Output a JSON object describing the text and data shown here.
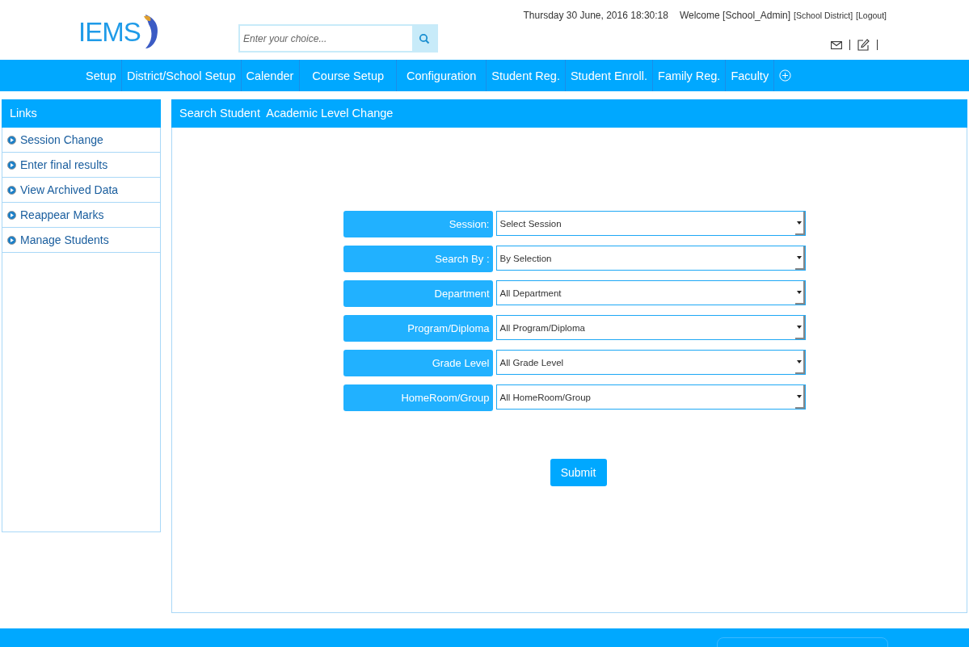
{
  "header": {
    "logo_text": "IEMS",
    "search": {
      "placeholder": "Enter your choice..."
    },
    "datetime": "Thursday 30 June, 2016 18:30:18",
    "welcome": "Welcome [School_Admin]",
    "district_link": "[School District]",
    "logout_link": "[Logout]"
  },
  "nav": [
    {
      "label": "Setup"
    },
    {
      "label": "District/School Setup"
    },
    {
      "label": "Calender"
    },
    {
      "label": "Course Setup"
    },
    {
      "label": "Configuration"
    },
    {
      "label": "Student Reg."
    },
    {
      "label": "Student Enroll."
    },
    {
      "label": "Family Reg."
    },
    {
      "label": "Faculty"
    }
  ],
  "sidebar": {
    "title": "Links",
    "items": [
      {
        "label": "Session Change"
      },
      {
        "label": "Enter final results"
      },
      {
        "label": "View Archived Data"
      },
      {
        "label": "Reappear Marks"
      },
      {
        "label": "Manage Students"
      }
    ]
  },
  "panel": {
    "title": "Search Student  Academic Level Change",
    "fields": [
      {
        "label": "Session:",
        "value": "Select Session"
      },
      {
        "label": "Search By :",
        "value": "By Selection"
      },
      {
        "label": "Department",
        "value": "All Department"
      },
      {
        "label": "Program/Diploma",
        "value": "All Program/Diploma"
      },
      {
        "label": "Grade Level",
        "value": "All Grade Level"
      },
      {
        "label": "HomeRoom/Group",
        "value": "All HomeRoom/Group"
      }
    ],
    "submit": "Submit"
  }
}
